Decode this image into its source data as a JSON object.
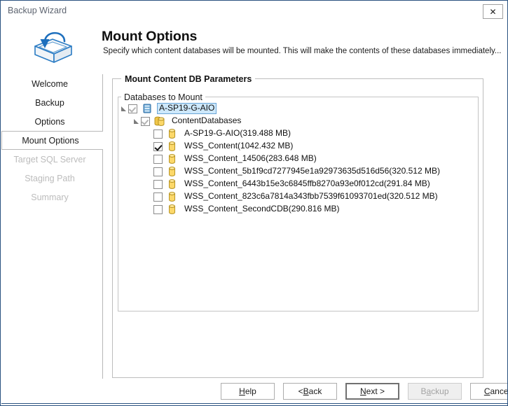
{
  "window": {
    "title": "Backup Wizard",
    "close_label": "✕",
    "accent_color": "#2a5280"
  },
  "header": {
    "logo_icon": "mount-box-arrow-icon",
    "title": "Mount Options",
    "subtitle": "Specify which content databases will be mounted. This will make the contents of these databases immediately..."
  },
  "sidebar": {
    "items": [
      {
        "label": "Welcome",
        "state": "done"
      },
      {
        "label": "Backup",
        "state": "done"
      },
      {
        "label": "Options",
        "state": "done"
      },
      {
        "label": "Mount Options",
        "state": "active"
      },
      {
        "label": "Target SQL Server",
        "state": "disabled"
      },
      {
        "label": "Staging Path",
        "state": "disabled"
      },
      {
        "label": "Summary",
        "state": "disabled"
      }
    ]
  },
  "main": {
    "group_outer_label": "Mount Content DB Parameters",
    "group_inner_label": "Databases to Mount",
    "tree": {
      "selected_highlight": "#cde8fb",
      "nodes": [
        {
          "label": "A-SP19-G-AIO",
          "indent": 0,
          "twisty": "expanded",
          "checkbox": "partial",
          "icon": "server-database-icon",
          "selected": true
        },
        {
          "label": "ContentDatabases",
          "indent": 1,
          "twisty": "expanded",
          "checkbox": "partial",
          "icon": "database-group-icon",
          "selected": false
        },
        {
          "label": "A-SP19-G-AIO(319.488 MB)",
          "indent": 2,
          "twisty": "none",
          "checkbox": "unchecked",
          "icon": "database-icon",
          "selected": false
        },
        {
          "label": "WSS_Content(1042.432 MB)",
          "indent": 2,
          "twisty": "none",
          "checkbox": "checked",
          "icon": "database-icon",
          "selected": false
        },
        {
          "label": "WSS_Content_14506(283.648 MB)",
          "indent": 2,
          "twisty": "none",
          "checkbox": "unchecked",
          "icon": "database-icon",
          "selected": false
        },
        {
          "label": "WSS_Content_5b1f9cd7277945e1a92973635d516d56(320.512 MB)",
          "indent": 2,
          "twisty": "none",
          "checkbox": "unchecked",
          "icon": "database-icon",
          "selected": false
        },
        {
          "label": "WSS_Content_6443b15e3c6845ffb8270a93e0f012cd(291.84 MB)",
          "indent": 2,
          "twisty": "none",
          "checkbox": "unchecked",
          "icon": "database-icon",
          "selected": false
        },
        {
          "label": "WSS_Content_823c6a7814a343fbb7539f61093701ed(320.512 MB)",
          "indent": 2,
          "twisty": "none",
          "checkbox": "unchecked",
          "icon": "database-icon",
          "selected": false
        },
        {
          "label": "WSS_Content_SecondCDB(290.816 MB)",
          "indent": 2,
          "twisty": "none",
          "checkbox": "unchecked",
          "icon": "database-icon",
          "selected": false
        }
      ]
    }
  },
  "footer": {
    "buttons": [
      {
        "name": "help",
        "pre": "",
        "accel": "H",
        "post": "elp",
        "state": "normal"
      },
      {
        "name": "back",
        "pre": "< ",
        "accel": "B",
        "post": "ack",
        "state": "normal"
      },
      {
        "name": "next",
        "pre": "",
        "accel": "N",
        "post": "ext >",
        "state": "default"
      },
      {
        "name": "backup",
        "pre": "B",
        "accel": "a",
        "post": "ckup",
        "state": "disabled"
      },
      {
        "name": "cancel",
        "pre": "",
        "accel": "C",
        "post": "ancel",
        "state": "normal"
      }
    ]
  }
}
